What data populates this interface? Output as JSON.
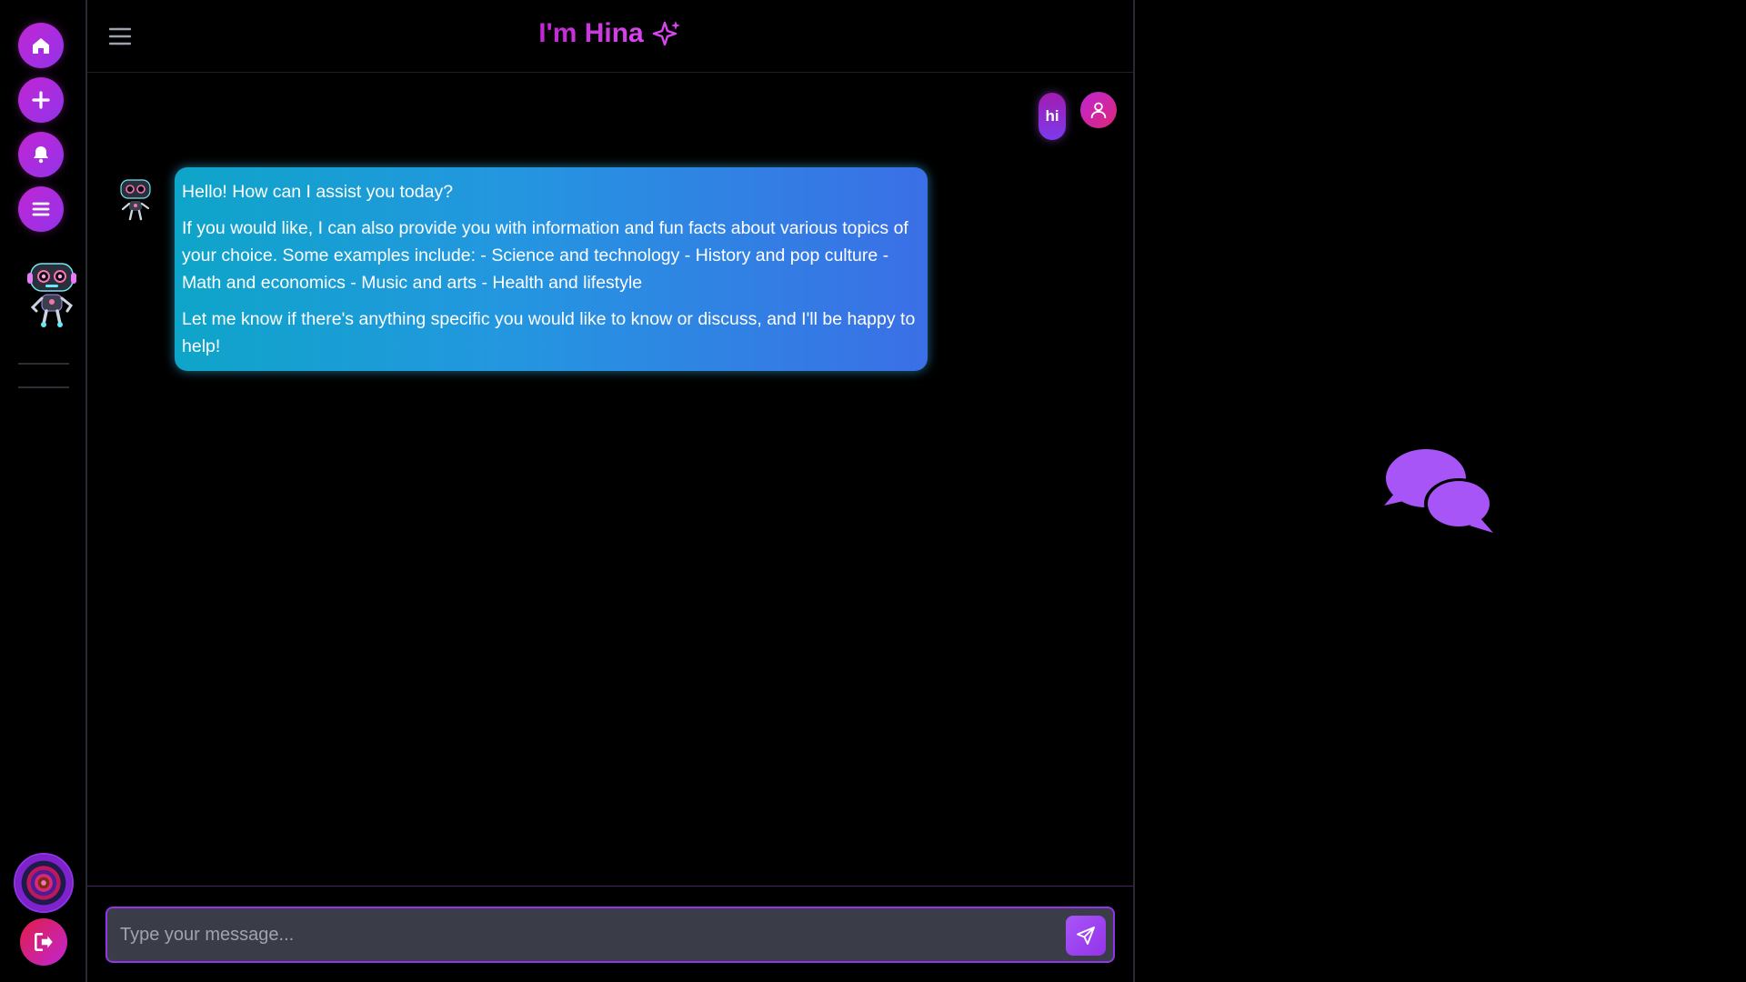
{
  "header": {
    "title": "I'm Hina"
  },
  "sidebar": {
    "items": [
      {
        "name": "home",
        "icon": "home-icon"
      },
      {
        "name": "new",
        "icon": "plus-icon"
      },
      {
        "name": "notifications",
        "icon": "bell-icon"
      },
      {
        "name": "menu",
        "icon": "list-icon"
      }
    ],
    "logout_icon": "logout-icon"
  },
  "messages": [
    {
      "role": "user",
      "text": "hi"
    },
    {
      "role": "assistant",
      "paragraphs": [
        "Hello! How can I assist you today?",
        "If you would like, I can also provide you with information and fun facts about various topics of your choice. Some examples include: - Science and technology - History and pop culture - Math and economics - Music and arts - Health and lifestyle",
        "Let me know if there's anything specific you would like to know or discuss, and I'll be happy to help!"
      ]
    }
  ],
  "composer": {
    "placeholder": "Type your message...",
    "value": ""
  },
  "colors": {
    "accent": "#9333ea",
    "magenta": "#c026d3",
    "bubble_start": "#0ea5c9",
    "bubble_end": "#3b6fe6"
  }
}
